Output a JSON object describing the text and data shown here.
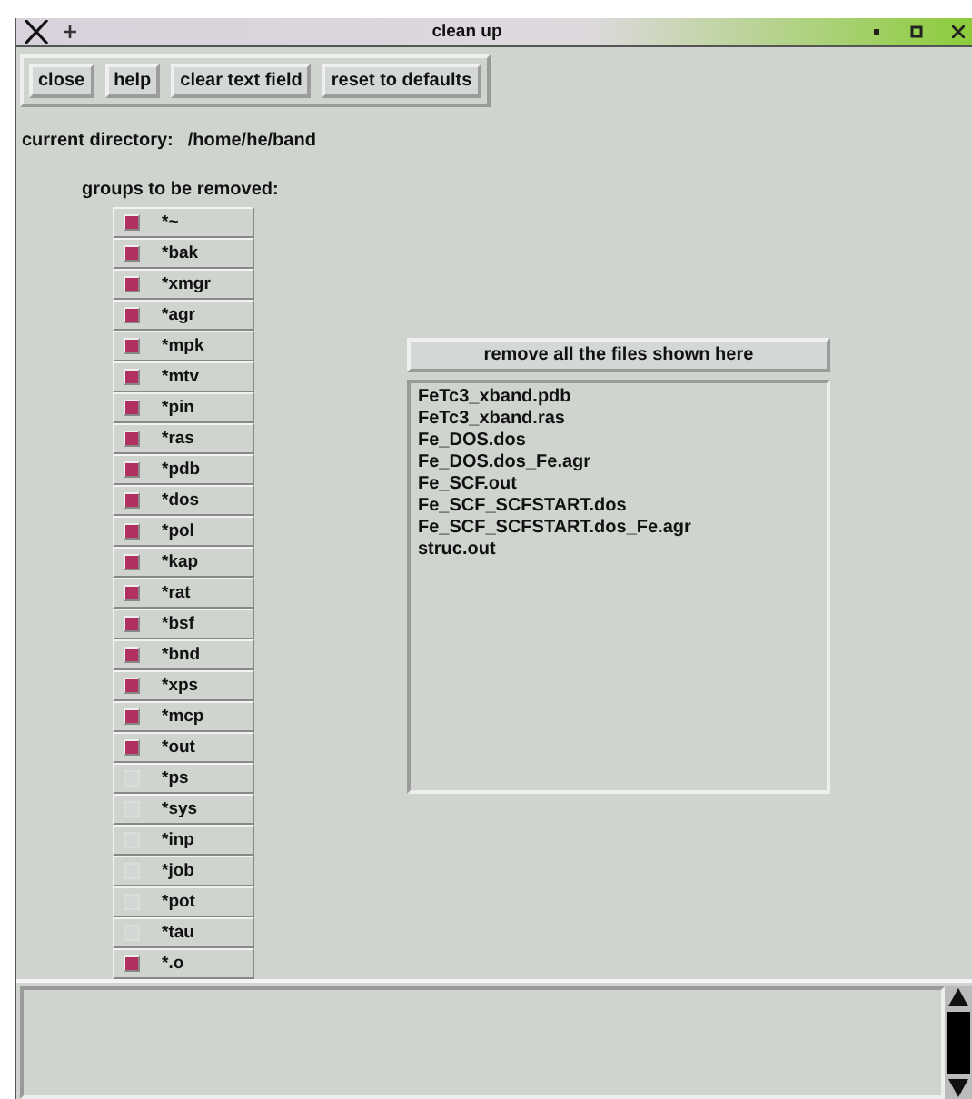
{
  "window": {
    "title": "clean up"
  },
  "buttons": [
    "close",
    "help",
    "clear text field",
    "reset to defaults"
  ],
  "directory": {
    "label": "current directory:",
    "path": "/home/he/band"
  },
  "groups": {
    "label": "groups to be removed:",
    "items": [
      {
        "pattern": "*~",
        "checked": true
      },
      {
        "pattern": "*bak",
        "checked": true
      },
      {
        "pattern": "*xmgr",
        "checked": true
      },
      {
        "pattern": "*agr",
        "checked": true
      },
      {
        "pattern": "*mpk",
        "checked": true
      },
      {
        "pattern": "*mtv",
        "checked": true
      },
      {
        "pattern": "*pin",
        "checked": true
      },
      {
        "pattern": "*ras",
        "checked": true
      },
      {
        "pattern": "*pdb",
        "checked": true
      },
      {
        "pattern": "*dos",
        "checked": true
      },
      {
        "pattern": "*pol",
        "checked": true
      },
      {
        "pattern": "*kap",
        "checked": true
      },
      {
        "pattern": "*rat",
        "checked": true
      },
      {
        "pattern": "*bsf",
        "checked": true
      },
      {
        "pattern": "*bnd",
        "checked": true
      },
      {
        "pattern": "*xps",
        "checked": true
      },
      {
        "pattern": "*mcp",
        "checked": true
      },
      {
        "pattern": "*out",
        "checked": true
      },
      {
        "pattern": "*ps",
        "checked": false
      },
      {
        "pattern": "*sys",
        "checked": false
      },
      {
        "pattern": "*inp",
        "checked": false
      },
      {
        "pattern": "*job",
        "checked": false
      },
      {
        "pattern": "*pot",
        "checked": false
      },
      {
        "pattern": "*tau",
        "checked": false
      },
      {
        "pattern": "*.o",
        "checked": true
      }
    ]
  },
  "remove_button": "remove all the files shown here",
  "files": [
    "FeTc3_xband.pdb",
    "FeTc3_xband.ras",
    "Fe_DOS.dos",
    "Fe_DOS.dos_Fe.agr",
    "Fe_SCF.out",
    "Fe_SCF_SCFSTART.dos",
    "Fe_SCF_SCFSTART.dos_Fe.agr",
    "struc.out"
  ]
}
